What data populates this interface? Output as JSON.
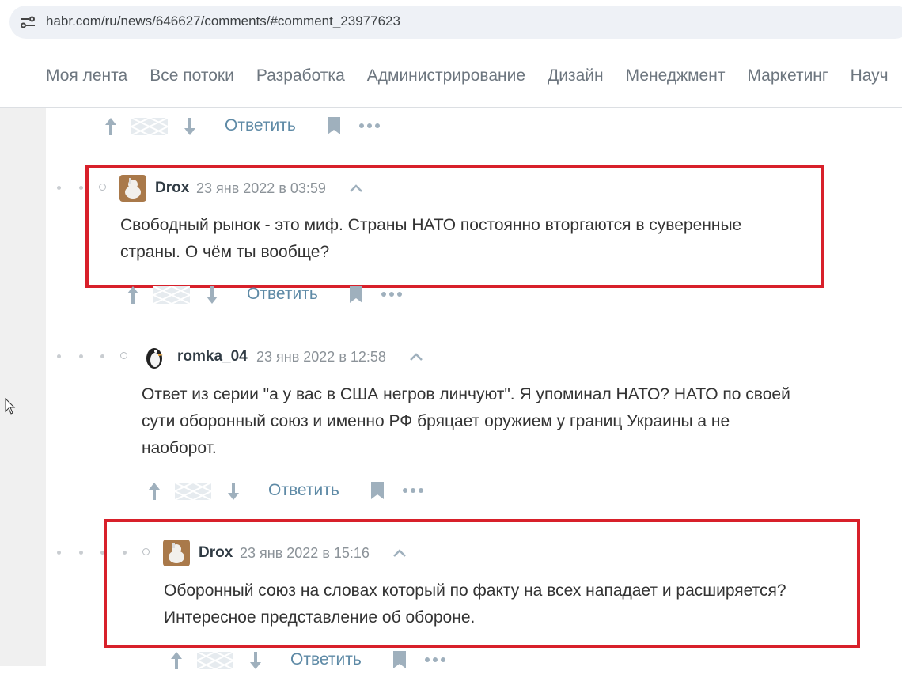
{
  "browser": {
    "url": "habr.com/ru/news/646627/comments/#comment_23977623"
  },
  "nav": {
    "items": [
      "Моя лента",
      "Все потоки",
      "Разработка",
      "Администрирование",
      "Дизайн",
      "Менеджмент",
      "Маркетинг",
      "Науч"
    ]
  },
  "actions": {
    "reply_label": "Ответить"
  },
  "comments": [
    {
      "author": "Drox",
      "date": "23 янв 2022 в 03:59",
      "lines": [
        "Свободный рынок - это миф. Страны НАТО постоянно вторгаются в суверенные",
        "страны. О чём ты вообще?"
      ]
    },
    {
      "author": "romka_04",
      "date": "23 янв 2022 в 12:58",
      "lines": [
        "Ответ из серии \"а у вас в США негров линчуют\". Я упоминал НАТО? НАТО по своей",
        "сути оборонный союз и именно РФ бряцает оружием у границ Украины а не",
        "наоборот."
      ]
    },
    {
      "author": "Drox",
      "date": "23 янв 2022 в 15:16",
      "lines": [
        "Оборонный союз на словах который по факту на всех нападает и расширяется?",
        "Интересное представление об обороне."
      ]
    }
  ],
  "colors": {
    "highlight": "#d8202a",
    "link": "#5e8aa6",
    "author": "#303b44"
  }
}
